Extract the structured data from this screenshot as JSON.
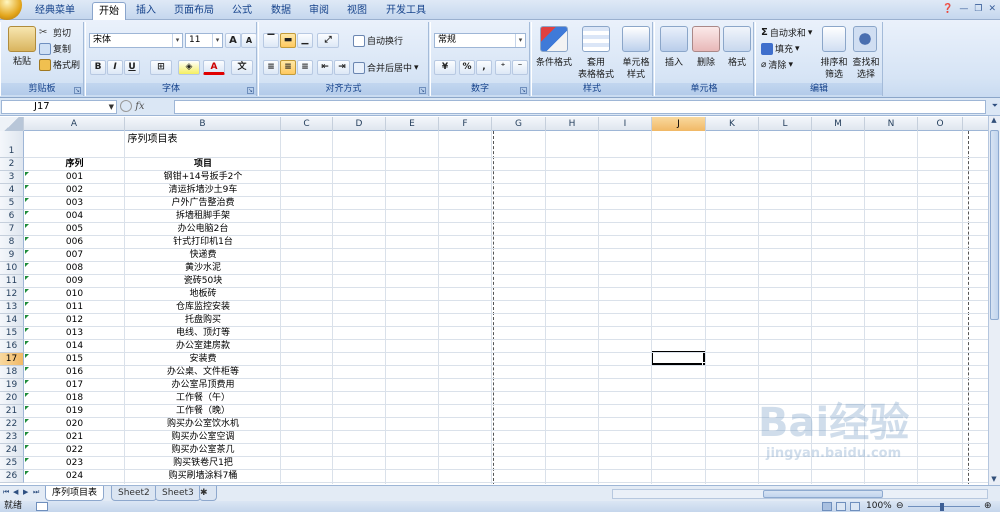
{
  "ribbon_tabs": [
    "经典菜单",
    "开始",
    "插入",
    "页面布局",
    "公式",
    "数据",
    "审阅",
    "视图",
    "开发工具"
  ],
  "clipboard": {
    "paste": "粘贴",
    "cut": "剪切",
    "copy": "复制",
    "format_painter": "格式刷",
    "label": "剪贴板"
  },
  "font": {
    "name": "宋体",
    "size": "11",
    "grow": "A",
    "shrink": "A",
    "bold": "B",
    "italic": "I",
    "underline": "U",
    "label": "字体",
    "wen": "文"
  },
  "alignment": {
    "wrap": "自动换行",
    "merge": "合并后居中",
    "label": "对齐方式"
  },
  "number": {
    "format": "常规",
    "label": "数字",
    "percent": "%",
    "comma": ","
  },
  "styles": {
    "cond": "条件格式",
    "table1": "套用",
    "table2": "表格格式",
    "cell1": "单元格",
    "cell2": "样式",
    "label": "样式"
  },
  "cells": {
    "insert": "插入",
    "delete": "删除",
    "format": "格式",
    "label": "单元格"
  },
  "editing": {
    "autosum": "自动求和",
    "fill": "填充",
    "clear": "清除",
    "sort1": "排序和",
    "sort2": "筛选",
    "find1": "查找和",
    "find2": "选择",
    "label": "编辑"
  },
  "namebox": "J17",
  "fx": "fx",
  "columns": [
    "A",
    "B",
    "C",
    "D",
    "E",
    "F",
    "G",
    "H",
    "I",
    "J",
    "K",
    "L",
    "M",
    "N",
    "O"
  ],
  "sheet_title": "序列项目表",
  "headers": {
    "seq": "序列",
    "item": "项目"
  },
  "rows": [
    [
      "001",
      "钢钳+14号扳手2个"
    ],
    [
      "002",
      "清运拆墙沙土9车"
    ],
    [
      "003",
      "户外广告整治费"
    ],
    [
      "004",
      "拆墙租脚手架"
    ],
    [
      "005",
      "办公电脑2台"
    ],
    [
      "006",
      "针式打印机1台"
    ],
    [
      "007",
      "快递费"
    ],
    [
      "008",
      "黄沙水泥"
    ],
    [
      "009",
      "瓷砖50块"
    ],
    [
      "010",
      "地板砖"
    ],
    [
      "011",
      "仓库监控安装"
    ],
    [
      "012",
      "托盘购买"
    ],
    [
      "013",
      "电线、顶灯等"
    ],
    [
      "014",
      "办公室建房款"
    ],
    [
      "015",
      "安装费"
    ],
    [
      "016",
      "办公桌、文件柜等"
    ],
    [
      "017",
      "办公室吊顶费用"
    ],
    [
      "018",
      "工作餐（午）"
    ],
    [
      "019",
      "工作餐（晚）"
    ],
    [
      "020",
      "购买办公室饮水机"
    ],
    [
      "021",
      "购买办公室空调"
    ],
    [
      "022",
      "购买办公室茶几"
    ],
    [
      "023",
      "购买铁卷尺1把"
    ],
    [
      "024",
      "购买刷墙涂料7桶"
    ]
  ],
  "sheet_tabs": [
    "序列项目表",
    "Sheet2",
    "Sheet3"
  ],
  "status": "就绪",
  "zoom": "100%",
  "watermark": "Bai经验",
  "watermark_url": "jingyan.baidu.com"
}
